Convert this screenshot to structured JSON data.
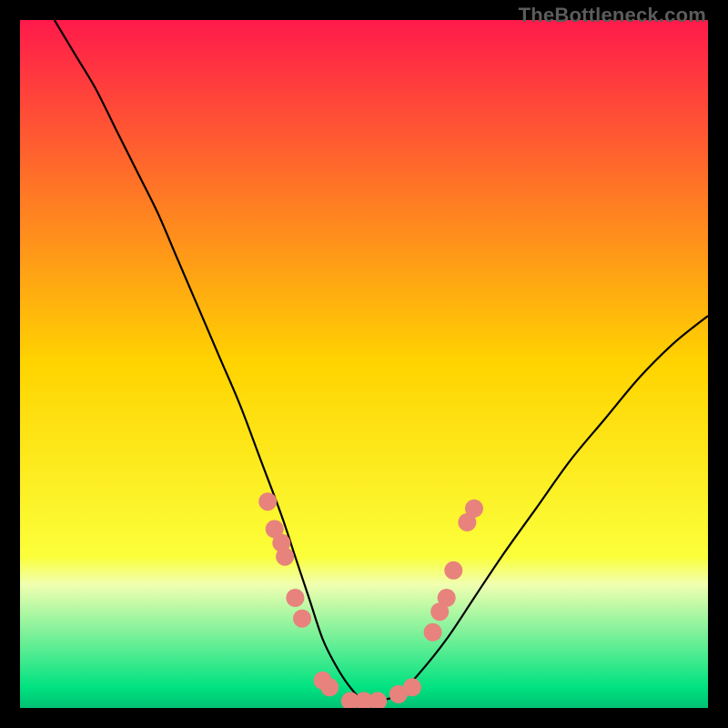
{
  "watermark": "TheBottleneck.com",
  "chart_data": {
    "type": "line",
    "title": "",
    "xlabel": "",
    "ylabel": "",
    "xlim": [
      0,
      100
    ],
    "ylim": [
      0,
      100
    ],
    "grid": false,
    "legend": false,
    "background_gradient": {
      "stops": [
        {
          "pos": 0.0,
          "color": "#ff1a4b"
        },
        {
          "pos": 0.5,
          "color": "#ffd400"
        },
        {
          "pos": 0.78,
          "color": "#fbff3a"
        },
        {
          "pos": 0.82,
          "color": "#f1ffb0"
        },
        {
          "pos": 0.97,
          "color": "#00e281"
        },
        {
          "pos": 1.0,
          "color": "#00c173"
        }
      ]
    },
    "series": [
      {
        "name": "bottleneck-curve",
        "color": "#000000",
        "x": [
          5,
          8,
          11,
          14,
          17,
          20,
          23,
          26,
          29,
          32,
          35,
          38,
          40,
          42,
          44,
          46,
          48,
          50,
          52,
          55,
          58,
          62,
          66,
          70,
          75,
          80,
          85,
          90,
          95,
          100
        ],
        "y": [
          100,
          95,
          90,
          84,
          78,
          72,
          65,
          58,
          51,
          44,
          36,
          28,
          22,
          16,
          10,
          6,
          3,
          1,
          1,
          2,
          5,
          10,
          16,
          22,
          29,
          36,
          42,
          48,
          53,
          57
        ]
      }
    ],
    "markers": {
      "name": "sample-points",
      "color": "#e8827d",
      "radius": 10,
      "points": [
        {
          "x": 36,
          "y": 30
        },
        {
          "x": 37,
          "y": 26
        },
        {
          "x": 38,
          "y": 24
        },
        {
          "x": 38.5,
          "y": 22
        },
        {
          "x": 40,
          "y": 16
        },
        {
          "x": 41,
          "y": 13
        },
        {
          "x": 44,
          "y": 4
        },
        {
          "x": 45,
          "y": 3
        },
        {
          "x": 48,
          "y": 1
        },
        {
          "x": 50,
          "y": 1
        },
        {
          "x": 52,
          "y": 1
        },
        {
          "x": 55,
          "y": 2
        },
        {
          "x": 57,
          "y": 3
        },
        {
          "x": 60,
          "y": 11
        },
        {
          "x": 61,
          "y": 14
        },
        {
          "x": 62,
          "y": 16
        },
        {
          "x": 63,
          "y": 20
        },
        {
          "x": 65,
          "y": 27
        },
        {
          "x": 66,
          "y": 29
        }
      ]
    }
  }
}
